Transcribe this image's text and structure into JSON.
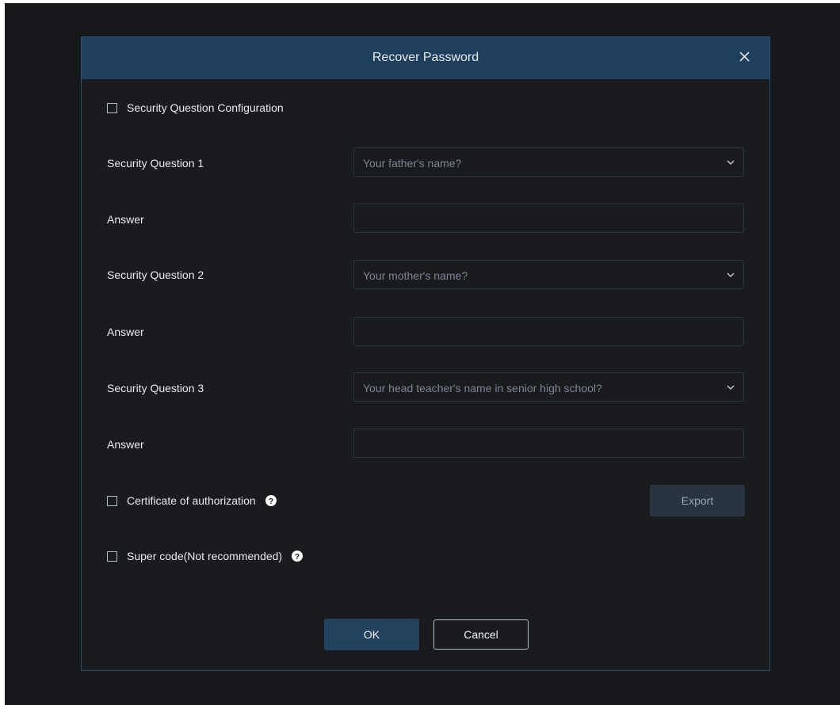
{
  "dialog": {
    "title": "Recover Password",
    "close_icon": "close-icon"
  },
  "security_config": {
    "label": "Security Question Configuration",
    "checked": false
  },
  "questions": [
    {
      "label": "Security Question 1",
      "selected": "Your father's name?",
      "answer_label": "Answer",
      "answer_value": ""
    },
    {
      "label": "Security Question 2",
      "selected": "Your mother's name?",
      "answer_label": "Answer",
      "answer_value": ""
    },
    {
      "label": "Security Question 3",
      "selected": "Your head teacher's name in senior high school?",
      "answer_label": "Answer",
      "answer_value": ""
    }
  ],
  "certificate": {
    "label": "Certificate of authorization",
    "checked": false,
    "export_label": "Export"
  },
  "super_code": {
    "label": "Super code(Not recommended)",
    "checked": false
  },
  "footer": {
    "ok_label": "OK",
    "cancel_label": "Cancel"
  },
  "colors": {
    "background": "#17181b",
    "titlebar": "#1f3f5c",
    "accent_button": "#24415e",
    "disabled_button": "#2a3340",
    "border": "#2a4f70"
  }
}
